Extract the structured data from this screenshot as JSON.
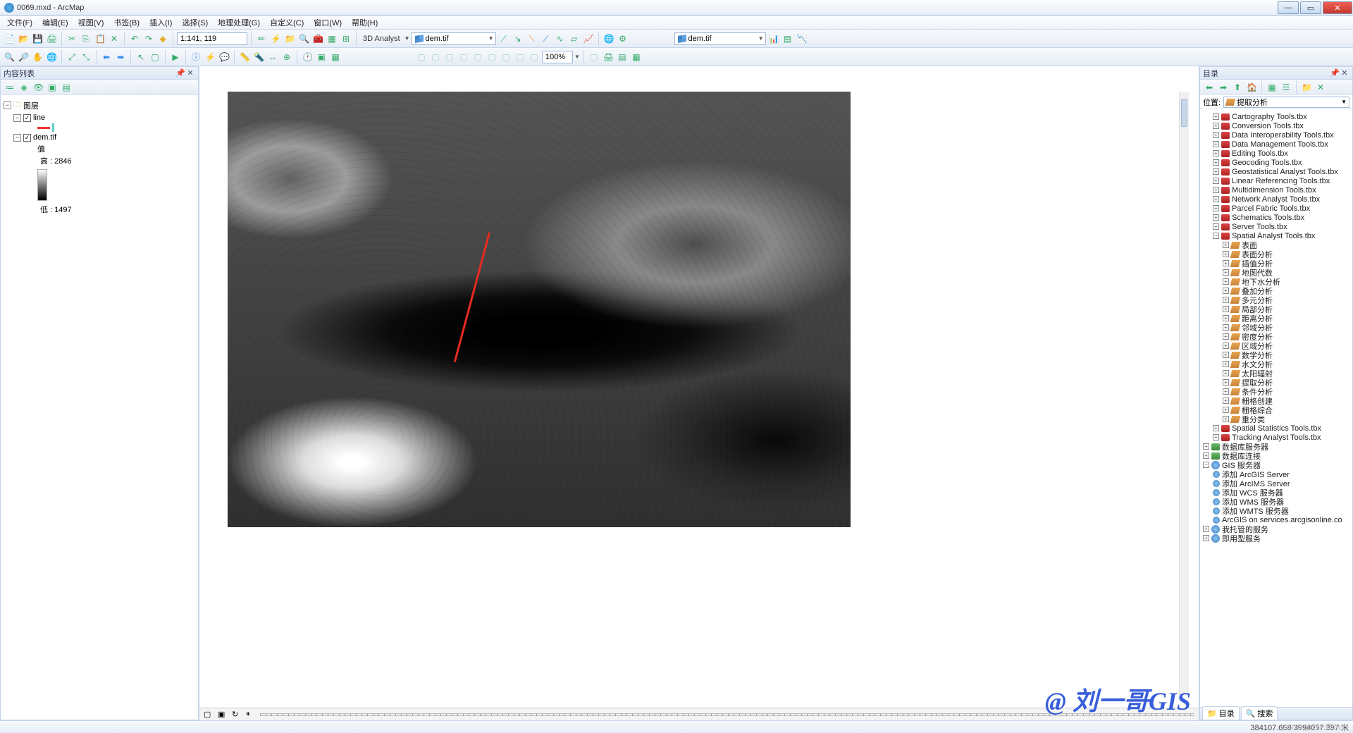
{
  "window": {
    "title": "0069.mxd - ArcMap"
  },
  "menu": [
    "文件(F)",
    "编辑(E)",
    "视图(V)",
    "书签(B)",
    "插入(I)",
    "选择(S)",
    "地理处理(G)",
    "自定义(C)",
    "窗口(W)",
    "帮助(H)"
  ],
  "toolbar1": {
    "scale": "1:141, 119",
    "analyst_label": "3D Analyst",
    "layer1": "dem.tif",
    "layer2": "dem.tif",
    "zoom_pct": "100%"
  },
  "toc": {
    "title": "内容列表",
    "root": "图层",
    "layers": {
      "line": {
        "name": "line",
        "checked": true
      },
      "dem": {
        "name": "dem.tif",
        "checked": true,
        "value_label": "值",
        "high": "高 : 2846",
        "low": "低 : 1497"
      }
    }
  },
  "catalog": {
    "title": "目录",
    "location_label": "位置:",
    "location_value": "提取分析",
    "toolboxes": [
      "Cartography Tools.tbx",
      "Conversion Tools.tbx",
      "Data Interoperability Tools.tbx",
      "Data Management Tools.tbx",
      "Editing Tools.tbx",
      "Geocoding Tools.tbx",
      "Geostatistical Analyst Tools.tbx",
      "Linear Referencing Tools.tbx",
      "Multidimension Tools.tbx",
      "Network Analyst Tools.tbx",
      "Parcel Fabric Tools.tbx",
      "Schematics Tools.tbx",
      "Server Tools.tbx"
    ],
    "spatial_analyst": {
      "name": "Spatial Analyst Tools.tbx",
      "toolsets": [
        "表面",
        "表面分析",
        "插值分析",
        "地图代数",
        "地下水分析",
        "叠加分析",
        "多元分析",
        "局部分析",
        "距离分析",
        "邻域分析",
        "密度分析",
        "区域分析",
        "数学分析",
        "水文分析",
        "太阳辐射",
        "提取分析",
        "条件分析",
        "栅格创建",
        "栅格综合",
        "重分类"
      ]
    },
    "toolboxes_after": [
      "Spatial Statistics Tools.tbx",
      "Tracking Analyst Tools.tbx"
    ],
    "servers": {
      "db_server": "数据库服务器",
      "db_conn": "数据库连接",
      "gis_server": "GIS 服务器",
      "items": [
        "添加 ArcGIS Server",
        "添加 ArcIMS Server",
        "添加 WCS 服务器",
        "添加 WMS 服务器",
        "添加 WMTS 服务器",
        "ArcGIS on services.arcgisonline.co"
      ],
      "hosted": "我托管的服务",
      "ready": "即用型服务"
    },
    "tabs": {
      "catalog": "目录",
      "search": "搜索"
    }
  },
  "status": {
    "coords": "384107.658 3994057.397 米"
  },
  "watermark": "@ 刘一哥GIS",
  "watermark2": "CSDN @刘一哥GIS"
}
